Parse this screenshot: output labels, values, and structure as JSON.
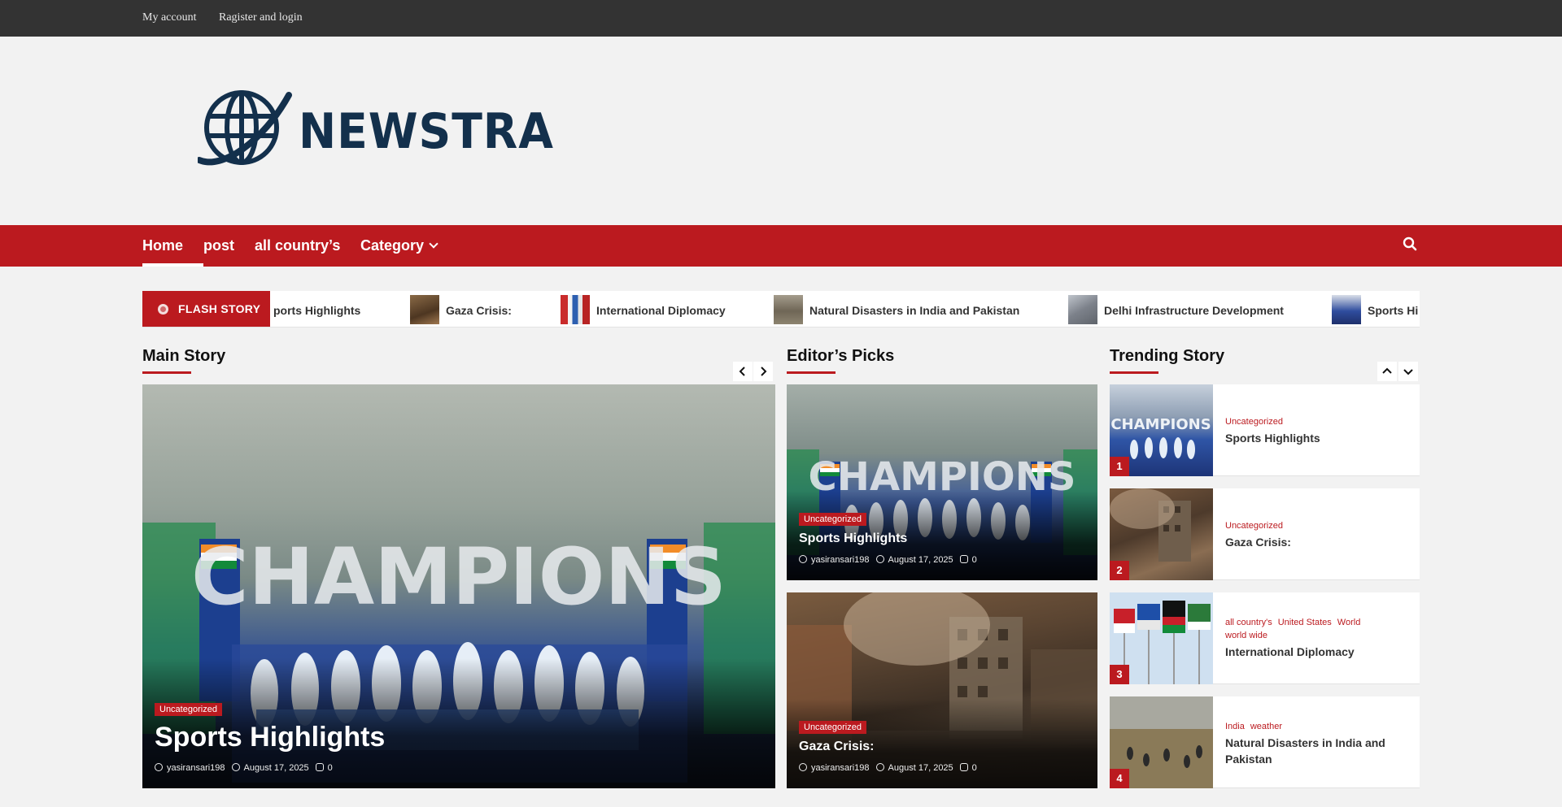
{
  "topbar": {
    "my_account": "My account",
    "register_login": "Ragister and login"
  },
  "logo": {
    "text": "NEWSTRA"
  },
  "nav": {
    "items": [
      "Home",
      "post",
      "all country’s",
      "Category"
    ],
    "icon": "search-icon"
  },
  "ticker": {
    "label": "FLASH STORY",
    "items": [
      "ports Highlights",
      "Gaza Crisis:",
      "International Diplomacy",
      "Natural Disasters in India and Pakistan",
      "Delhi Infrastructure Development",
      "Sports Hi"
    ]
  },
  "sections": {
    "main": "Main Story",
    "editors": "Editor’s Picks",
    "trending": "Trending Story"
  },
  "main_story": {
    "category": "Uncategorized",
    "title": "Sports Highlights",
    "author": "yasiransari198",
    "date": "August 17, 2025",
    "comments": "0"
  },
  "editors_picks": [
    {
      "category": "Uncategorized",
      "title": "Sports Highlights",
      "author": "yasiransari198",
      "date": "August 17, 2025",
      "comments": "0"
    },
    {
      "category": "Uncategorized",
      "title": "Gaza Crisis:",
      "author": "yasiransari198",
      "date": "August 17, 2025",
      "comments": "0"
    }
  ],
  "trending": [
    {
      "num": "1",
      "cats": [
        "Uncategorized"
      ],
      "title": "Sports Highlights"
    },
    {
      "num": "2",
      "cats": [
        "Uncategorized"
      ],
      "title": "Gaza Crisis:"
    },
    {
      "num": "3",
      "cats": [
        "all country's",
        "United States",
        "World",
        "world wide"
      ],
      "title": "International Diplomacy"
    },
    {
      "num": "4",
      "cats": [
        "India",
        "weather"
      ],
      "title": "Natural Disasters in India and Pakistan"
    }
  ],
  "colors": {
    "accent": "#bb1a1f",
    "topbar": "#333333",
    "logo": "#13304c"
  }
}
